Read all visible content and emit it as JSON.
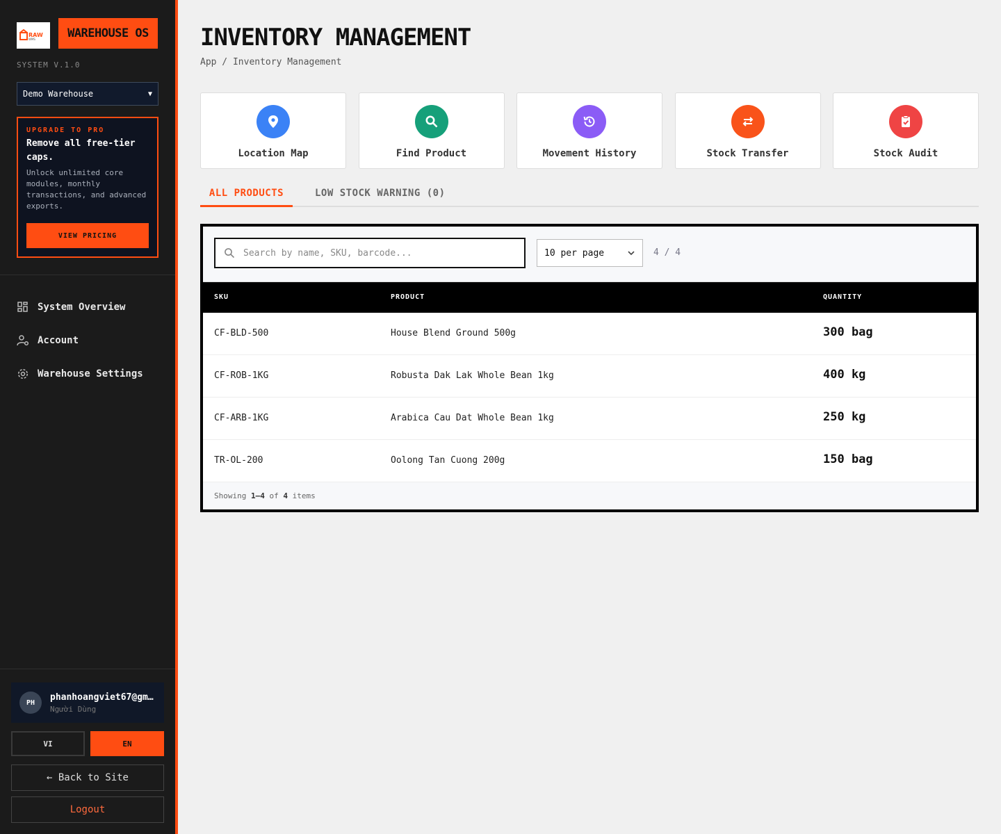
{
  "sidebar": {
    "logo_text": "RAW",
    "brand": "WAREHOUSE OS",
    "version": "SYSTEM V.1.0",
    "warehouse_selected": "Demo Warehouse",
    "upgrade": {
      "kicker": "UPGRADE TO PRO",
      "heading": "Remove all free-tier caps.",
      "text": "Unlock unlimited core modules, monthly transactions, and advanced exports.",
      "button": "VIEW PRICING"
    },
    "nav": [
      {
        "label": "System Overview",
        "icon": "dashboard-icon"
      },
      {
        "label": "Account",
        "icon": "user-gear-icon"
      },
      {
        "label": "Warehouse Settings",
        "icon": "gear-icon"
      }
    ],
    "user": {
      "initials": "PH",
      "name": "phanhoangviet67@gmail.com",
      "role": "Người Dùng"
    },
    "lang": {
      "vi": "VI",
      "en": "EN",
      "active": "EN"
    },
    "back": "← Back to Site",
    "logout": "Logout"
  },
  "colors": {
    "accent": "#ff4d12",
    "sidebar_bg": "#1b1b1b",
    "page_bg": "#f0f0f0"
  },
  "header": {
    "title": "INVENTORY MANAGEMENT",
    "breadcrumb": "App / Inventory Management"
  },
  "quick_actions": [
    {
      "label": "Location Map",
      "icon": "map-pin-icon",
      "color": "#3b82f6"
    },
    {
      "label": "Find Product",
      "icon": "search-icon",
      "color": "#16a07a"
    },
    {
      "label": "Movement History",
      "icon": "history-icon",
      "color": "#8b5cf6"
    },
    {
      "label": "Stock Transfer",
      "icon": "transfer-icon",
      "color": "#f9531a"
    },
    {
      "label": "Stock Audit",
      "icon": "clipboard-check-icon",
      "color": "#ef4444"
    }
  ],
  "tabs": {
    "all": "ALL PRODUCTS",
    "low": "LOW STOCK WARNING (0)",
    "active": "all"
  },
  "toolbar": {
    "search_placeholder": "Search by name, SKU, barcode...",
    "per_page": "10 per page",
    "count": "4 / 4"
  },
  "table": {
    "headers": {
      "sku": "SKU",
      "product": "PRODUCT",
      "quantity": "QUANTITY"
    },
    "rows": [
      {
        "sku": "CF-BLD-500",
        "product": "House Blend Ground 500g",
        "quantity": "300 bag"
      },
      {
        "sku": "CF-ROB-1KG",
        "product": "Robusta Dak Lak Whole Bean 1kg",
        "quantity": "400 kg"
      },
      {
        "sku": "CF-ARB-1KG",
        "product": "Arabica Cau Dat Whole Bean 1kg",
        "quantity": "250 kg"
      },
      {
        "sku": "TR-OL-200",
        "product": "Oolong Tan Cuong 200g",
        "quantity": "150 bag"
      }
    ],
    "footer": {
      "prefix": "Showing",
      "range": "1–4",
      "of": "of",
      "total": "4",
      "suffix": "items"
    }
  }
}
